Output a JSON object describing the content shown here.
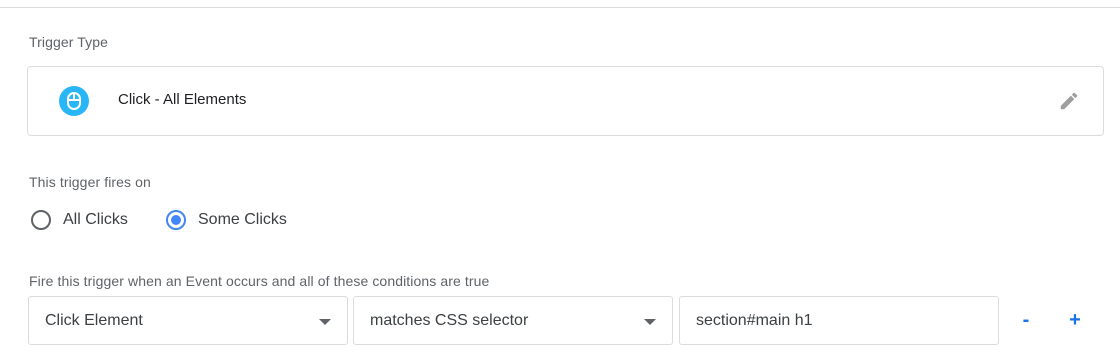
{
  "trigger_type": {
    "label": "Trigger Type",
    "name": "Click - All Elements",
    "icon": "mouse-icon",
    "icon_color": "#29b6f6",
    "edit_icon": "pencil-icon"
  },
  "fires_on": {
    "label": "This trigger fires on",
    "options": [
      {
        "label": "All Clicks",
        "selected": false
      },
      {
        "label": "Some Clicks",
        "selected": true
      }
    ]
  },
  "conditions": {
    "label": "Fire this trigger when an Event occurs and all of these conditions are true",
    "rows": [
      {
        "variable": "Click Element",
        "operator": "matches CSS selector",
        "value": "section#main h1"
      }
    ],
    "remove_label": "-",
    "add_label": "+"
  },
  "colors": {
    "accent": "#4285f4",
    "link": "#1a73e8",
    "border": "#dadce0"
  }
}
